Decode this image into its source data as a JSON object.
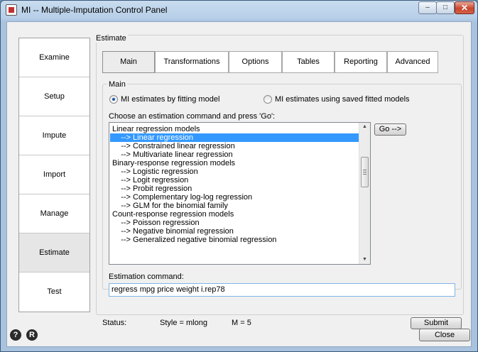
{
  "window": {
    "title": "MI -- Multiple-Imputation Control Panel",
    "minimize_glyph": "–",
    "maximize_glyph": "□",
    "close_glyph": "✕"
  },
  "sidebar": {
    "items": [
      {
        "label": "Examine"
      },
      {
        "label": "Setup"
      },
      {
        "label": "Impute"
      },
      {
        "label": "Import"
      },
      {
        "label": "Manage"
      },
      {
        "label": "Estimate",
        "active": true
      },
      {
        "label": "Test"
      }
    ]
  },
  "estimate": {
    "group_label": "Estimate",
    "tabs": [
      {
        "label": "Main",
        "active": true
      },
      {
        "label": "Transformations"
      },
      {
        "label": "Options"
      },
      {
        "label": "Tables"
      },
      {
        "label": "Reporting"
      },
      {
        "label": "Advanced"
      }
    ],
    "main": {
      "group_label": "Main",
      "radio_fit": "MI estimates by fitting model",
      "radio_saved": "MI estimates using saved fitted models",
      "selected_radio": "fit",
      "choose_label": "Choose an estimation command and press 'Go':",
      "commands": [
        "Linear regression models",
        "    --> Linear regression",
        "    --> Constrained linear regression",
        "    --> Multivariate linear regression",
        "Binary-response regression models",
        "    --> Logistic regression",
        "    --> Logit regression",
        "    --> Probit regression",
        "    --> Complementary log-log regression",
        "    --> GLM for the binomial family",
        "Count-response regression models",
        "    --> Poisson regression",
        "    --> Negative binomial regression",
        "    --> Generalized negative binomial regression"
      ],
      "selected_index": 1,
      "go_label": "Go -->",
      "estimation_label": "Estimation command:",
      "estimation_value": "regress mpg price weight i.rep78"
    },
    "status_label": "Status:",
    "style_text": "Style = mlong",
    "m_text": "M = 5",
    "submit_label": "Submit"
  },
  "footer": {
    "help_glyph": "?",
    "r_glyph": "R",
    "close_label": "Close"
  },
  "colors": {
    "selection": "#3399ff",
    "title_gradient_top": "#c9dcef",
    "close_button": "#c8472d"
  },
  "icons": {
    "help": "question-icon",
    "reset": "r-icon",
    "app": "stata-app-icon"
  }
}
